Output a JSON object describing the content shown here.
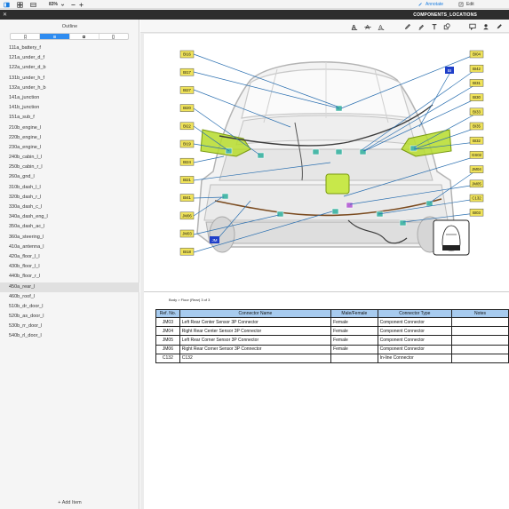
{
  "toolbar": {
    "zoom": "83%",
    "annotate_label": "Annotate",
    "edit_label": "Edit"
  },
  "window": {
    "title": "COMPONENTS_LOCATIONS"
  },
  "sidebar": {
    "title": "Outline",
    "items": [
      {
        "label": "111a_battery_f"
      },
      {
        "label": "121a_under_d_f"
      },
      {
        "label": "122a_under_d_b"
      },
      {
        "label": "131b_under_h_f"
      },
      {
        "label": "132a_under_h_b"
      },
      {
        "label": "141a_junction"
      },
      {
        "label": "141b_junction"
      },
      {
        "label": "151a_sub_f"
      },
      {
        "label": "210b_engine_l"
      },
      {
        "label": "220b_engine_l"
      },
      {
        "label": "230a_engine_l"
      },
      {
        "label": "240b_cabin_l_l"
      },
      {
        "label": "250b_cabin_r_l"
      },
      {
        "label": "260a_gnd_l"
      },
      {
        "label": "310b_dash_l_l"
      },
      {
        "label": "320b_dash_r_l"
      },
      {
        "label": "330a_dash_c_l"
      },
      {
        "label": "340a_dash_eng_l"
      },
      {
        "label": "350a_dash_ac_l"
      },
      {
        "label": "360a_steering_l"
      },
      {
        "label": "410a_antenna_l"
      },
      {
        "label": "420a_floor_l_l"
      },
      {
        "label": "430b_floor_l_l"
      },
      {
        "label": "440b_floor_r_l"
      },
      {
        "label": "450a_rear_l"
      },
      {
        "label": "460b_roof_l"
      },
      {
        "label": "510b_dr_door_l"
      },
      {
        "label": "520b_as_door_l"
      },
      {
        "label": "530b_rr_door_l"
      },
      {
        "label": "540b_rl_door_l"
      }
    ],
    "selected_index": 24,
    "add_item_label": "+ Add Item"
  },
  "diagram": {
    "left_labels": [
      "BI16",
      "BI17",
      "BI27",
      "BI20",
      "BI22",
      "BI19",
      "BI24",
      "BI21",
      "BI41",
      "JM06",
      "JM03",
      "BI18"
    ],
    "right_labels": [
      "BI04",
      "BI42",
      "BI31",
      "BI30",
      "BI33",
      "BI35",
      "BI32",
      "GS02",
      "JM04",
      "JM05",
      "C132",
      "BI03"
    ],
    "blue_labels": [
      "BI",
      "JM"
    ]
  },
  "content": {
    "breadcrumb": "Body > Floor (Rear)  3 of 3"
  },
  "table": {
    "headers": [
      "Ref. No.",
      "Connector Name",
      "Male/Female",
      "Connector Type",
      "Notes"
    ],
    "rows": [
      {
        "ref": "JM03",
        "name": "Left Rear Center Sensor 3P Connector",
        "mf": "Female",
        "type": "Component Connector",
        "notes": ""
      },
      {
        "ref": "JM04",
        "name": "Right Rear Center Sensor 3P Connector",
        "mf": "Female",
        "type": "Component Connector",
        "notes": ""
      },
      {
        "ref": "JM05",
        "name": "Left Rear Corner Sensor 3P Connector",
        "mf": "Female",
        "type": "Component Connector",
        "notes": ""
      },
      {
        "ref": "JM06",
        "name": "Right Rear Corner Sensor 3P Connector",
        "mf": "Female",
        "type": "Component Connector",
        "notes": ""
      },
      {
        "ref": "C132",
        "name": "C132",
        "mf": "",
        "type": "In-line Connector",
        "notes": ""
      }
    ]
  },
  "colors": {
    "accent": "#2f8cf0",
    "label_fill": "#f0e35a",
    "blue_label": "#1f3fc9",
    "table_header": "#a7cbef",
    "lamp_green": "#b6dc2c",
    "harness_brown": "#7a4a1e",
    "pointer_line": "#2a6fb0"
  }
}
